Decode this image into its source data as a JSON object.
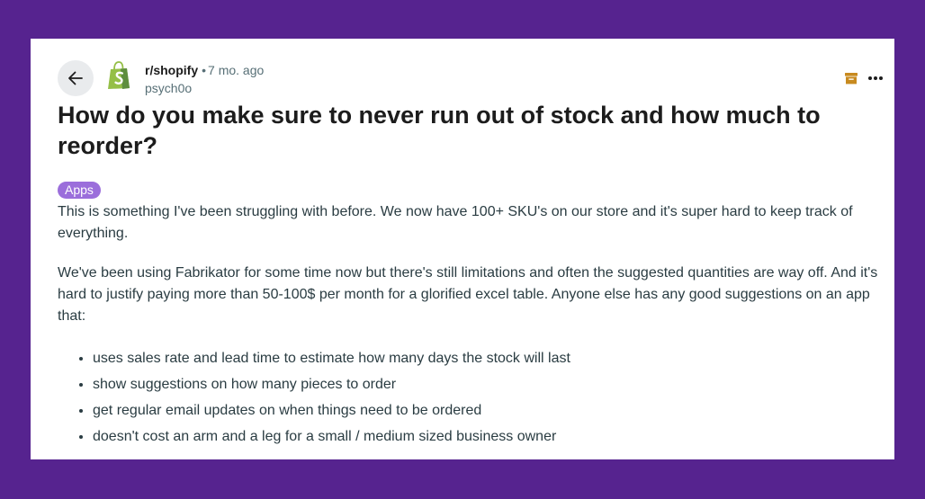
{
  "post": {
    "subreddit": "r/shopify",
    "separator": "•",
    "age": "7 mo. ago",
    "author": "psych0o",
    "title": "How do you make sure to never run out of stock and how much to reorder?",
    "flair": "Apps",
    "paragraphs": [
      "This is something I've been struggling with before. We now have 100+ SKU's on our store and it's super hard to keep track of everything.",
      "We've been using Fabrikator for some time now but there's still limitations and often the suggested quantities are way off. And it's hard to justify paying more than 50-100$ per month for a glorified excel table. Anyone else has any good suggestions on an app that:"
    ],
    "bullets": [
      "uses sales rate and lead time to estimate how many days the stock will last",
      "show suggestions on how many pieces to order",
      "get regular email updates on when things need to be ordered",
      "doesn't cost an arm and a leg for a small / medium sized business owner"
    ]
  },
  "icons": {
    "back": "arrow-left-icon",
    "subreddit": "shopify-bag-icon",
    "archive": "archive-icon",
    "more": "more-horizontal-icon"
  },
  "colors": {
    "background": "#56238f",
    "card": "#ffffff",
    "flair": "#9b6edb",
    "shopify_green": "#95bf47",
    "archive": "#c88a1f",
    "text": "#2a3c42"
  }
}
